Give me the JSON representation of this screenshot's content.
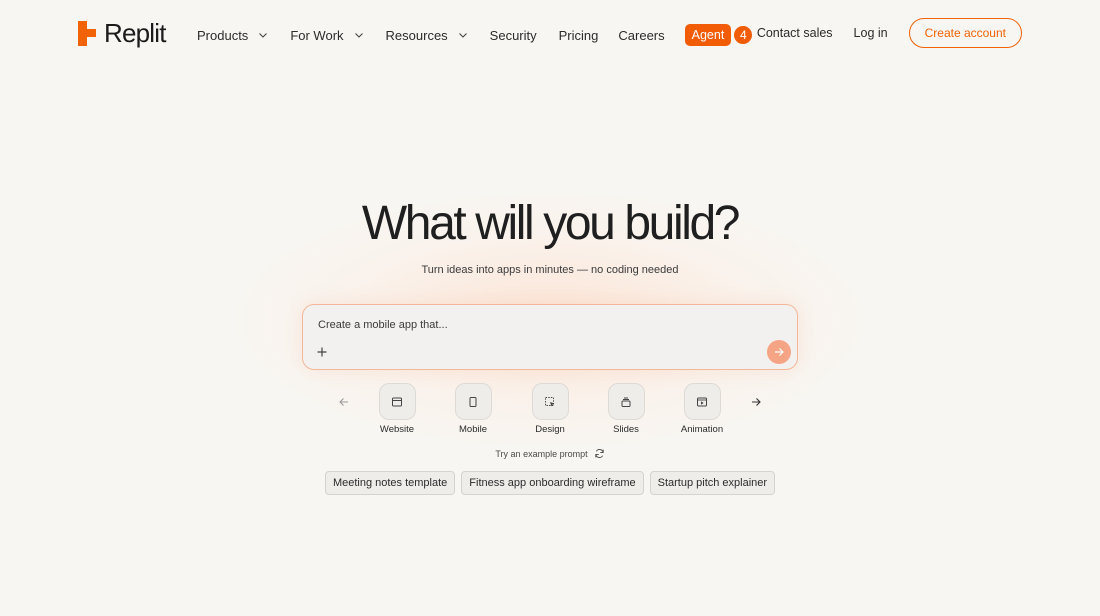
{
  "brand": {
    "name": "Replit",
    "color": "#f26207"
  },
  "nav": {
    "products": "Products",
    "for_work": "For Work",
    "resources": "Resources",
    "security": "Security",
    "pricing": "Pricing",
    "careers": "Careers",
    "agent": "Agent",
    "agent_badge": "4",
    "contact_sales": "Contact sales",
    "log_in": "Log in",
    "create_account": "Create account"
  },
  "hero": {
    "title": "What will you build?",
    "subtitle": "Turn ideas into apps in minutes — no coding needed",
    "prompt_placeholder": "Create a mobile app that..."
  },
  "categories": [
    {
      "label": "Website",
      "icon": "browser-window-icon"
    },
    {
      "label": "Mobile",
      "icon": "phone-icon"
    },
    {
      "label": "Design",
      "icon": "design-cursor-icon"
    },
    {
      "label": "Slides",
      "icon": "slides-stack-icon"
    },
    {
      "label": "Animation",
      "icon": "play-window-icon"
    }
  ],
  "try_example": "Try an example prompt",
  "example_prompts": [
    "Meeting notes template",
    "Fitness app onboarding wireframe",
    "Startup pitch explainer"
  ]
}
